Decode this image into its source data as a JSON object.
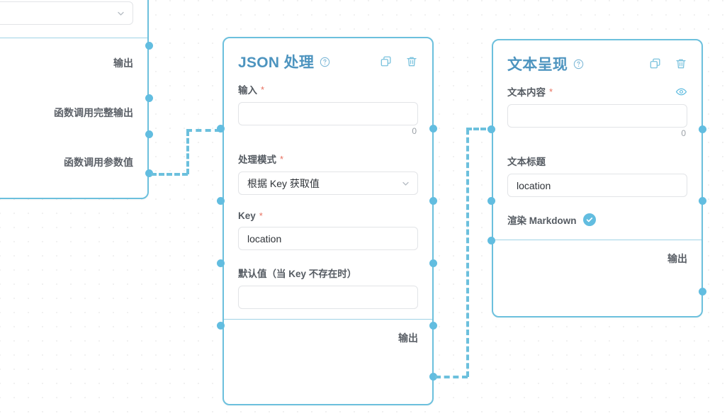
{
  "canvas": {
    "background": "#ffffff",
    "grid_dot_color": "#d0d0d0",
    "accent": "#6cc0dd",
    "title_color": "#4d94bf",
    "required_color": "#e8705f"
  },
  "nodes": {
    "left_partial": {
      "select_value": "",
      "outputs": [
        {
          "label": "输出"
        },
        {
          "label": "函数调用完整输出"
        },
        {
          "label": "函数调用参数值"
        }
      ]
    },
    "json_node": {
      "title": "JSON 处理",
      "help_icon": "question-circle-icon",
      "actions": [
        {
          "icon": "copy-icon",
          "name": "copy-node-button"
        },
        {
          "icon": "trash-icon",
          "name": "delete-node-button"
        }
      ],
      "fields": {
        "input": {
          "label": "输入",
          "required": true,
          "value": "",
          "placeholder": "",
          "counter": "0"
        },
        "mode": {
          "label": "处理模式",
          "required": true,
          "value": "根据 Key 获取值",
          "chevron": "chevron-down-icon"
        },
        "key": {
          "label": "Key",
          "required": true,
          "value": "location",
          "placeholder": ""
        },
        "default_value": {
          "label": "默认值（当 Key 不存在时）",
          "required": false,
          "value": "",
          "placeholder": ""
        }
      },
      "output_label": "输出"
    },
    "text_node": {
      "title": "文本呈现",
      "help_icon": "question-circle-icon",
      "actions": [
        {
          "icon": "copy-icon",
          "name": "copy-node-button"
        },
        {
          "icon": "trash-icon",
          "name": "delete-node-button"
        }
      ],
      "fields": {
        "content": {
          "label": "文本内容",
          "required": true,
          "value": "",
          "placeholder": "",
          "counter": "0",
          "eye_icon": "eye-icon"
        },
        "title": {
          "label": "文本标题",
          "required": false,
          "value": "location",
          "placeholder": ""
        },
        "markdown": {
          "label": "渲染 Markdown",
          "checked": true,
          "check_icon": "check-icon"
        }
      },
      "output_label": "输出"
    }
  }
}
